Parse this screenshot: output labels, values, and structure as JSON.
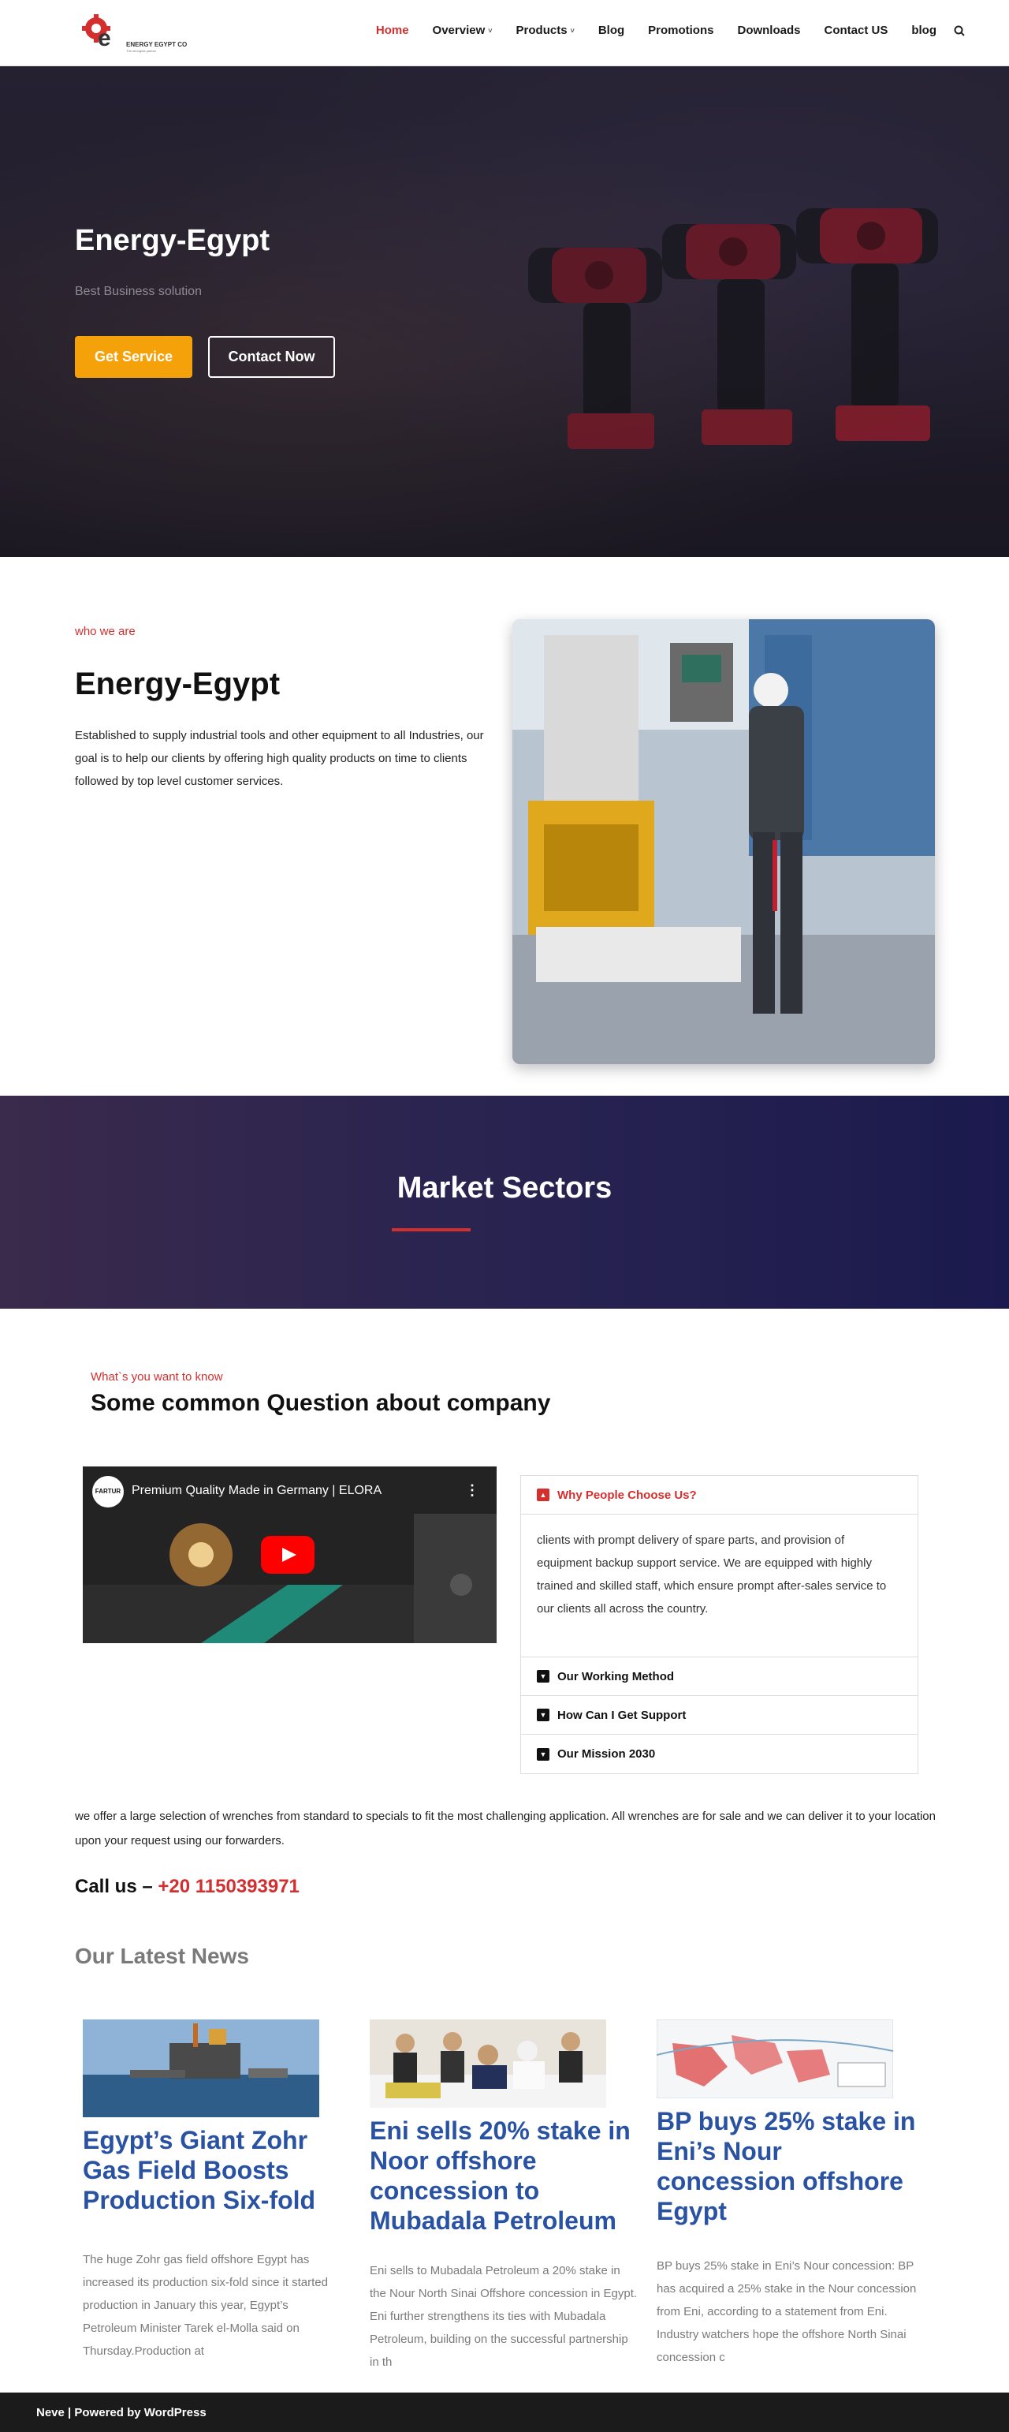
{
  "header": {
    "logo_text": "ENERGY EGYPT CO",
    "logo_sub": "The strongest partner",
    "nav": [
      {
        "label": "Home",
        "active": true,
        "has_caret": false
      },
      {
        "label": "Overview",
        "active": false,
        "has_caret": true
      },
      {
        "label": "Products",
        "active": false,
        "has_caret": true
      },
      {
        "label": "Blog",
        "active": false,
        "has_caret": false
      },
      {
        "label": "Promotions",
        "active": false,
        "has_caret": false
      },
      {
        "label": "Downloads",
        "active": false,
        "has_caret": false
      },
      {
        "label": "Contact US",
        "active": false,
        "has_caret": false
      },
      {
        "label": "blog",
        "active": false,
        "has_caret": false
      }
    ],
    "caret": "˅",
    "search_icon": "search-icon"
  },
  "hero": {
    "title": "Energy-Egypt",
    "subtitle": "Best Business solution",
    "primary_button": "Get Service",
    "secondary_button": "Contact Now"
  },
  "about": {
    "eyebrow": "who we are",
    "title": "Energy-Egypt",
    "text": "Established to supply industrial tools and other equipment to all Industries, our goal is to help our clients by offering high quality products on time to clients followed by top level customer services."
  },
  "sectors": {
    "title": "Market Sectors"
  },
  "faq": {
    "eyebrow": "What`s you want to know",
    "title": "Some common Question about company",
    "video": {
      "channel": "FARTUR",
      "title": "Premium Quality Made in Germany | ELORA",
      "menu": "⋮"
    },
    "items": [
      {
        "label": "Why People Choose Us?",
        "open": true,
        "icon": "▲",
        "body": "clients with prompt delivery of spare parts, and provision of equipment backup support service. We are equipped with highly trained and skilled staff, which ensure prompt after-sales service to our clients all across the country."
      },
      {
        "label": "Our Working Method",
        "open": false,
        "icon": "▼"
      },
      {
        "label": "How Can I Get Support",
        "open": false,
        "icon": "▼"
      },
      {
        "label": "Our Mission 2030",
        "open": false,
        "icon": "▼"
      }
    ]
  },
  "offer": {
    "text": "we offer a large selection of wrenches from standard to specials to fit the most challenging application. All wrenches are for sale and we can deliver it to your location upon your request using our forwarders.",
    "call_label": "Call us – ",
    "phone": "+20 1150393971"
  },
  "news": {
    "heading": "Our Latest News",
    "posts": [
      {
        "title": "Egypt’s Giant Zohr Gas Field Boosts Production Six-fold",
        "excerpt": "The huge Zohr gas field offshore Egypt has increased its production six-fold since it started production in January this year, Egypt’s Petroleum Minister Tarek el-Molla said on Thursday.Production at"
      },
      {
        "title": "Eni sells 20% stake in Noor offshore concession to Mubadala Petroleum",
        "excerpt": "Eni sells to Mubadala Petroleum a 20% stake in the Nour North Sinai Offshore concession in Egypt. Eni further strengthens its ties with Mubadala Petroleum, building on the successful partnership in th"
      },
      {
        "title": "BP buys 25% stake in Eni’s Nour concession offshore Egypt",
        "excerpt": "BP buys 25% stake in Eni’s Nour concession: BP has acquired a 25% stake in the Nour concession from Eni, according to a statement from Eni. Industry watchers hope the offshore North Sinai concession c"
      }
    ]
  },
  "footer": {
    "text": "Neve | Powered by WordPress"
  },
  "colors": {
    "accent_red": "#d32f2f",
    "button_orange": "#f5a20a",
    "news_blue": "#2952a3",
    "sectors_navy": "#1b1a4e"
  }
}
